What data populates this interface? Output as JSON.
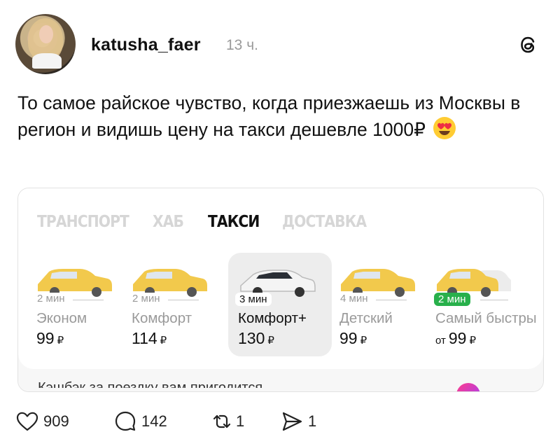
{
  "post": {
    "username": "katusha_faer",
    "time": "13 ч.",
    "text": "То самое райское чувство, когда приезжаешь из Москвы в регион и видишь цену на такси дешевле 1000₽",
    "emoji": "heart-eyes-emoji"
  },
  "card": {
    "tabs": [
      {
        "label": "ТРАНСПОРТ",
        "active": false
      },
      {
        "label": "ХАБ",
        "active": false
      },
      {
        "label": "ТАКСИ",
        "active": true
      },
      {
        "label": "ДОСТАВКА",
        "active": false
      }
    ],
    "options": [
      {
        "eta": "2 мин",
        "name": "Эконом",
        "price": "99",
        "prefix": "",
        "currency": "₽",
        "selected": false,
        "car_color": "#f2c94c"
      },
      {
        "eta": "2 мин",
        "name": "Комфорт",
        "price": "114",
        "prefix": "",
        "currency": "₽",
        "selected": false,
        "car_color": "#f2c94c"
      },
      {
        "eta": "3 мин",
        "name": "Комфорт+",
        "price": "130",
        "prefix": "",
        "currency": "₽",
        "selected": true,
        "car_color": "#f4f4f4"
      },
      {
        "eta": "4 мин",
        "name": "Детский",
        "price": "99",
        "prefix": "",
        "currency": "₽",
        "selected": false,
        "car_color": "#f2c94c"
      },
      {
        "eta": "2 мин",
        "name": "Самый быстры",
        "price": "99",
        "prefix": "от",
        "currency": "₽",
        "selected": false,
        "car_color": "#f2c94c"
      }
    ],
    "cashback_text": "Кэшбэк за поездку вам пригодится"
  },
  "actions": {
    "likes": "909",
    "comments": "142",
    "reposts": "1",
    "shares": "1"
  },
  "colors": {
    "accent_green": "#28b04b",
    "muted": "#9a9a9a"
  }
}
